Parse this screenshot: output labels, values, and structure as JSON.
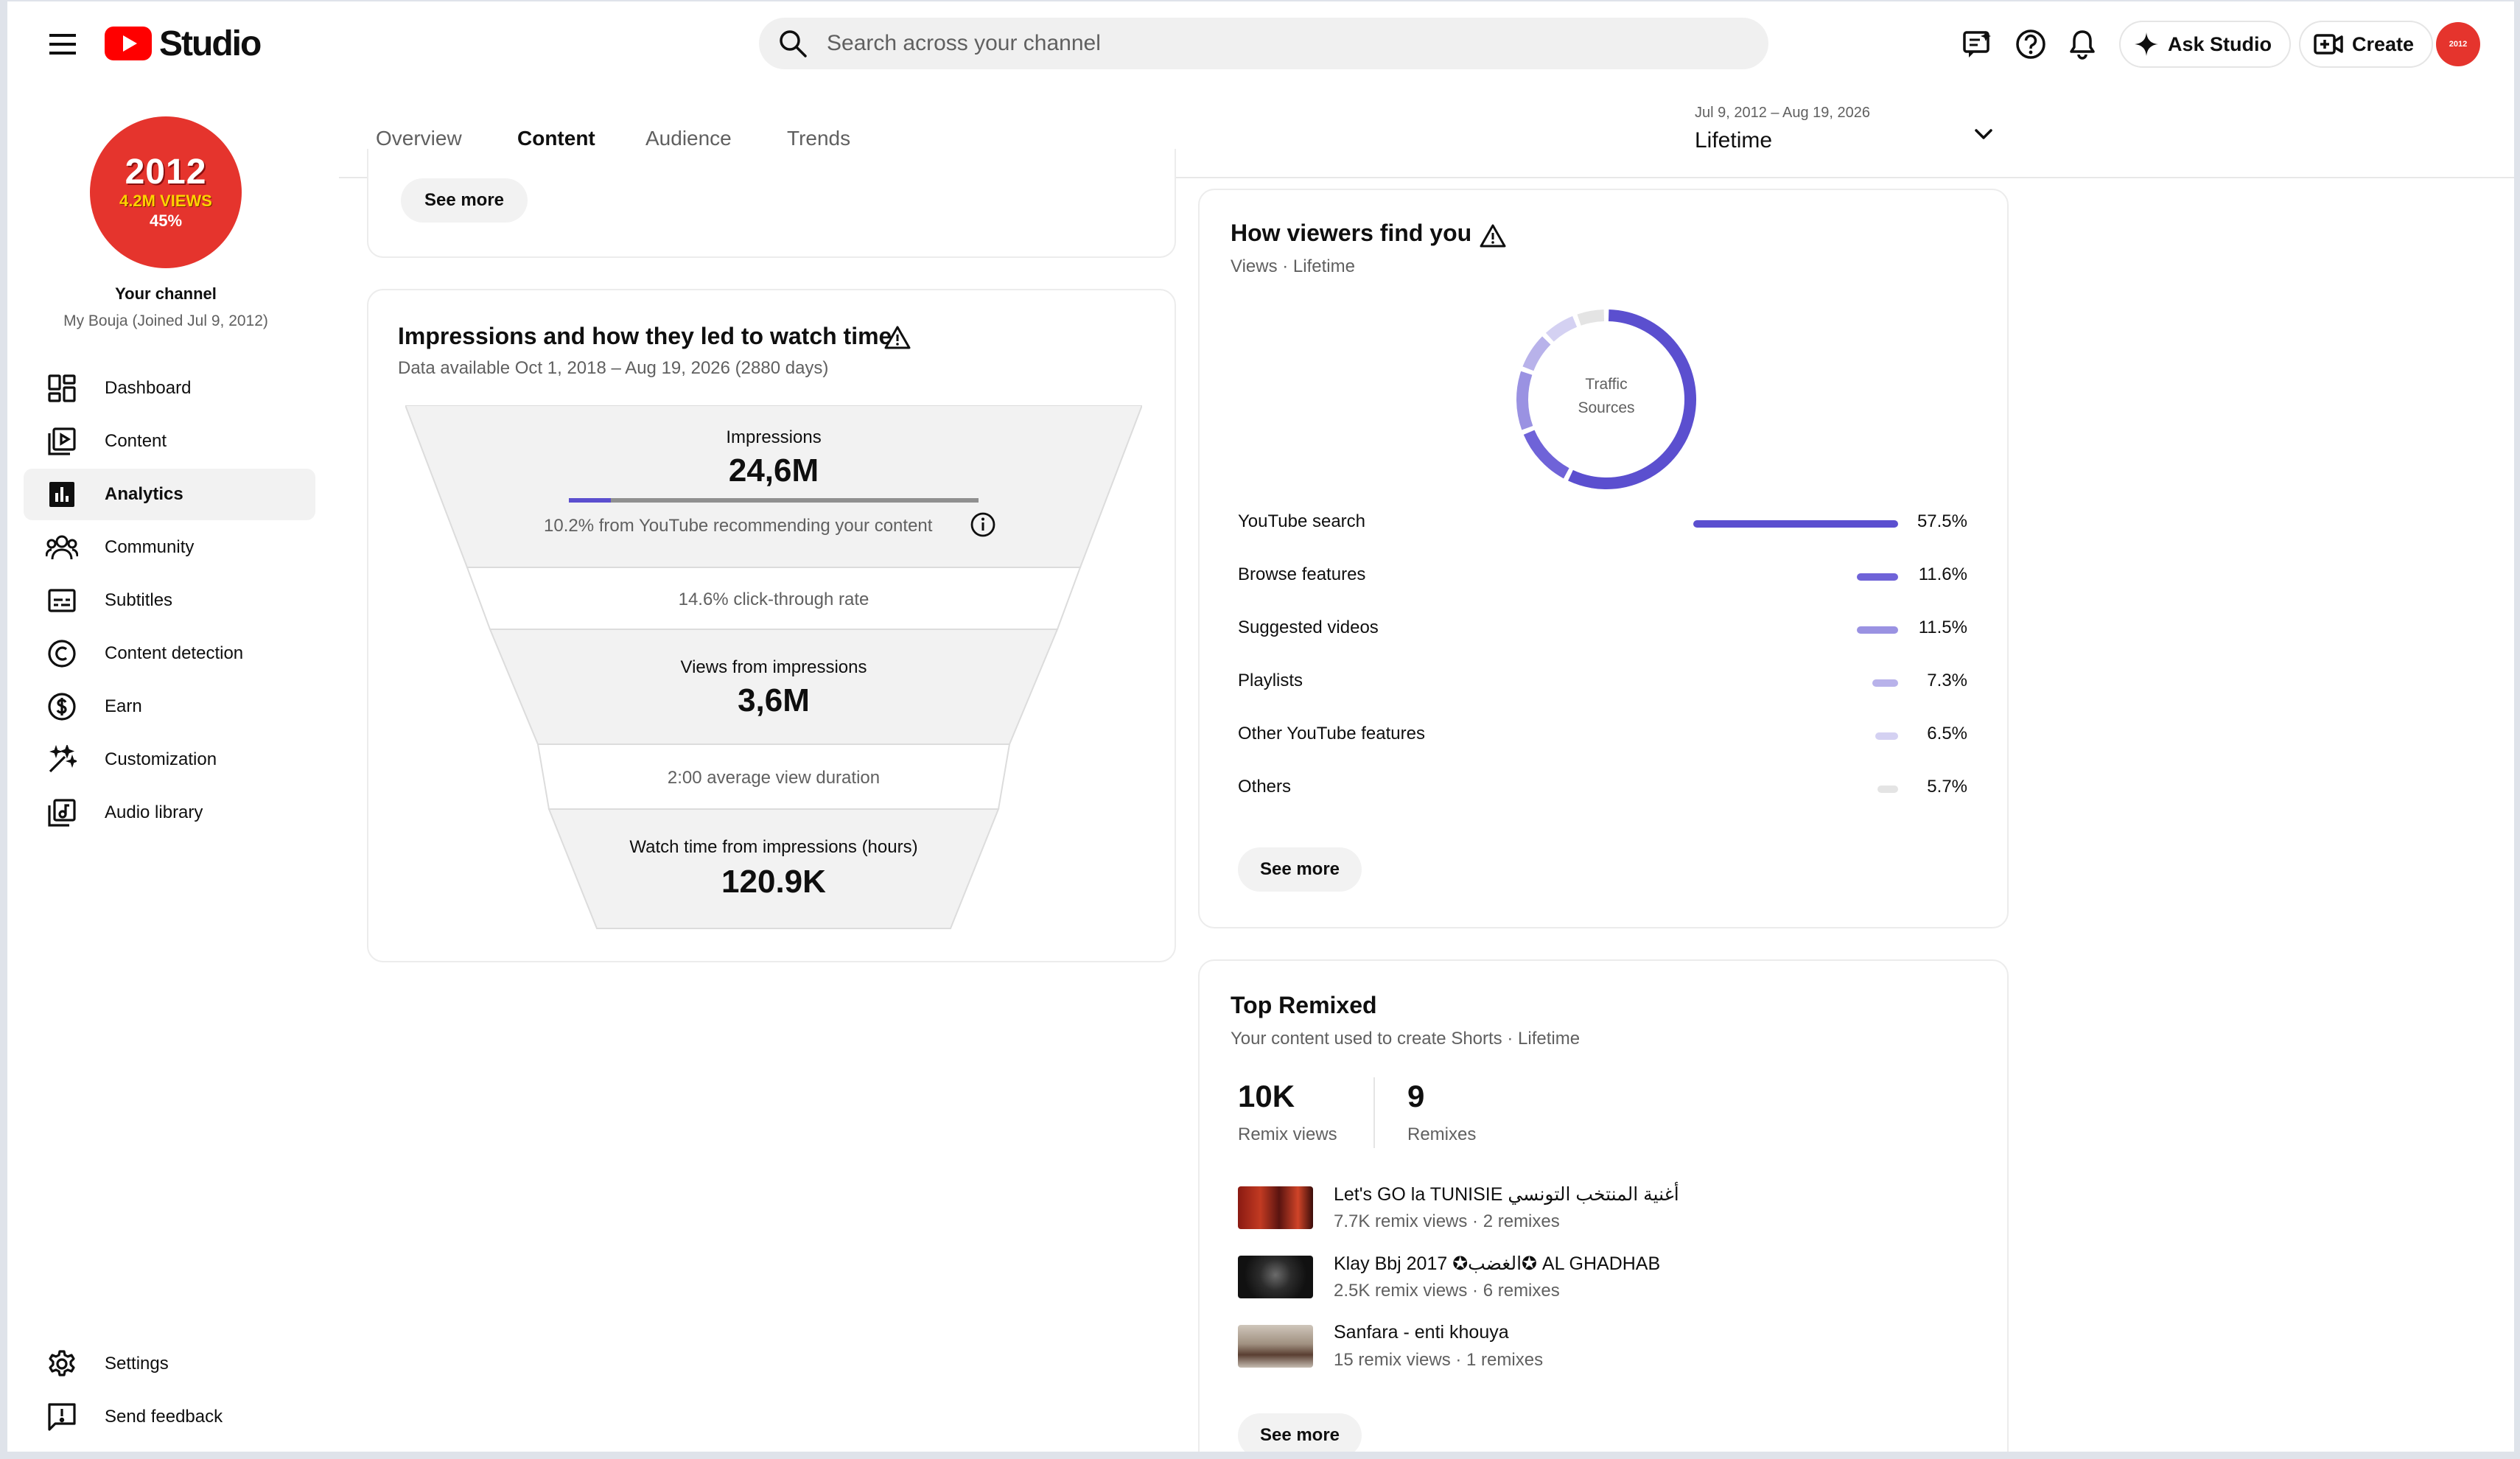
{
  "header": {
    "logo_text": "Studio",
    "search_placeholder": "Search across your channel",
    "ask_studio_label": "Ask Studio",
    "create_label": "Create",
    "avatar_text": "2012"
  },
  "sidebar": {
    "channel_avatar": {
      "year": "2012",
      "views": "4.2M VIEWS",
      "pct": "45%"
    },
    "channel_title": "Your channel",
    "channel_sub": "My Bouja (Joined Jul 9, 2012)",
    "items": [
      {
        "label": "Dashboard",
        "icon": "dashboard-icon"
      },
      {
        "label": "Content",
        "icon": "content-icon"
      },
      {
        "label": "Analytics",
        "icon": "analytics-icon"
      },
      {
        "label": "Community",
        "icon": "community-icon"
      },
      {
        "label": "Subtitles",
        "icon": "subtitles-icon"
      },
      {
        "label": "Content detection",
        "icon": "copyright-icon"
      },
      {
        "label": "Earn",
        "icon": "dollar-icon"
      },
      {
        "label": "Customization",
        "icon": "magic-wand-icon"
      },
      {
        "label": "Audio library",
        "icon": "audio-library-icon"
      }
    ],
    "settings_label": "Settings",
    "feedback_label": "Send feedback"
  },
  "tabs": [
    "Overview",
    "Content",
    "Audience",
    "Trends"
  ],
  "active_tab": "Content",
  "date_picker": {
    "range": "Jul 9, 2012 – Aug 19, 2026",
    "label": "Lifetime"
  },
  "top_card": {
    "see_more": "See more"
  },
  "funnel": {
    "title": "Impressions and how they led to watch time",
    "subtitle": "Data available Oct 1, 2018 – Aug 19, 2026 (2880 days)",
    "impressions_label": "Impressions",
    "impressions_value": "24,6M",
    "recommend_fraction": 0.102,
    "recommend_note": "10.2% from YouTube recommending your content",
    "ctr": "14.6% click-through rate",
    "views_label": "Views from impressions",
    "views_value": "3,6M",
    "avd": "2:00 average view duration",
    "watch_label": "Watch time from impressions (hours)",
    "watch_value": "120.9K"
  },
  "traffic": {
    "title": "How viewers find you",
    "subtitle": "Views · Lifetime",
    "donut_label_1": "Traffic",
    "donut_label_2": "Sources",
    "sources": [
      {
        "label": "YouTube search",
        "pct": "57.5%",
        "value": 57.5,
        "color": "#5b4fcf"
      },
      {
        "label": "Browse features",
        "pct": "11.6%",
        "value": 11.6,
        "color": "#6f63d8"
      },
      {
        "label": "Suggested videos",
        "pct": "11.5%",
        "value": 11.5,
        "color": "#9a92e2"
      },
      {
        "label": "Playlists",
        "pct": "7.3%",
        "value": 7.3,
        "color": "#b8b2ea"
      },
      {
        "label": "Other YouTube features",
        "pct": "6.5%",
        "value": 6.5,
        "color": "#d4d1f2"
      },
      {
        "label": "Others",
        "pct": "5.7%",
        "value": 5.7,
        "color": "#e4e4e4"
      }
    ],
    "see_more": "See more"
  },
  "remixed": {
    "title": "Top Remixed",
    "subtitle": "Your content used to create Shorts · Lifetime",
    "remix_views_value": "10K",
    "remix_views_label": "Remix views",
    "remixes_value": "9",
    "remixes_label": "Remixes",
    "items": [
      {
        "title": "Let's GO la TUNISIE أغنية المنتخب التونسي",
        "meta": "7.7K remix views · 2 remixes"
      },
      {
        "title": "Klay Bbj 2017 ✪الغضب✪ AL GHADHAB",
        "meta": "2.5K remix views · 6 remixes"
      },
      {
        "title": "Sanfara - enti khouya",
        "meta": "15 remix views · 1 remixes"
      }
    ],
    "see_more": "See more"
  }
}
